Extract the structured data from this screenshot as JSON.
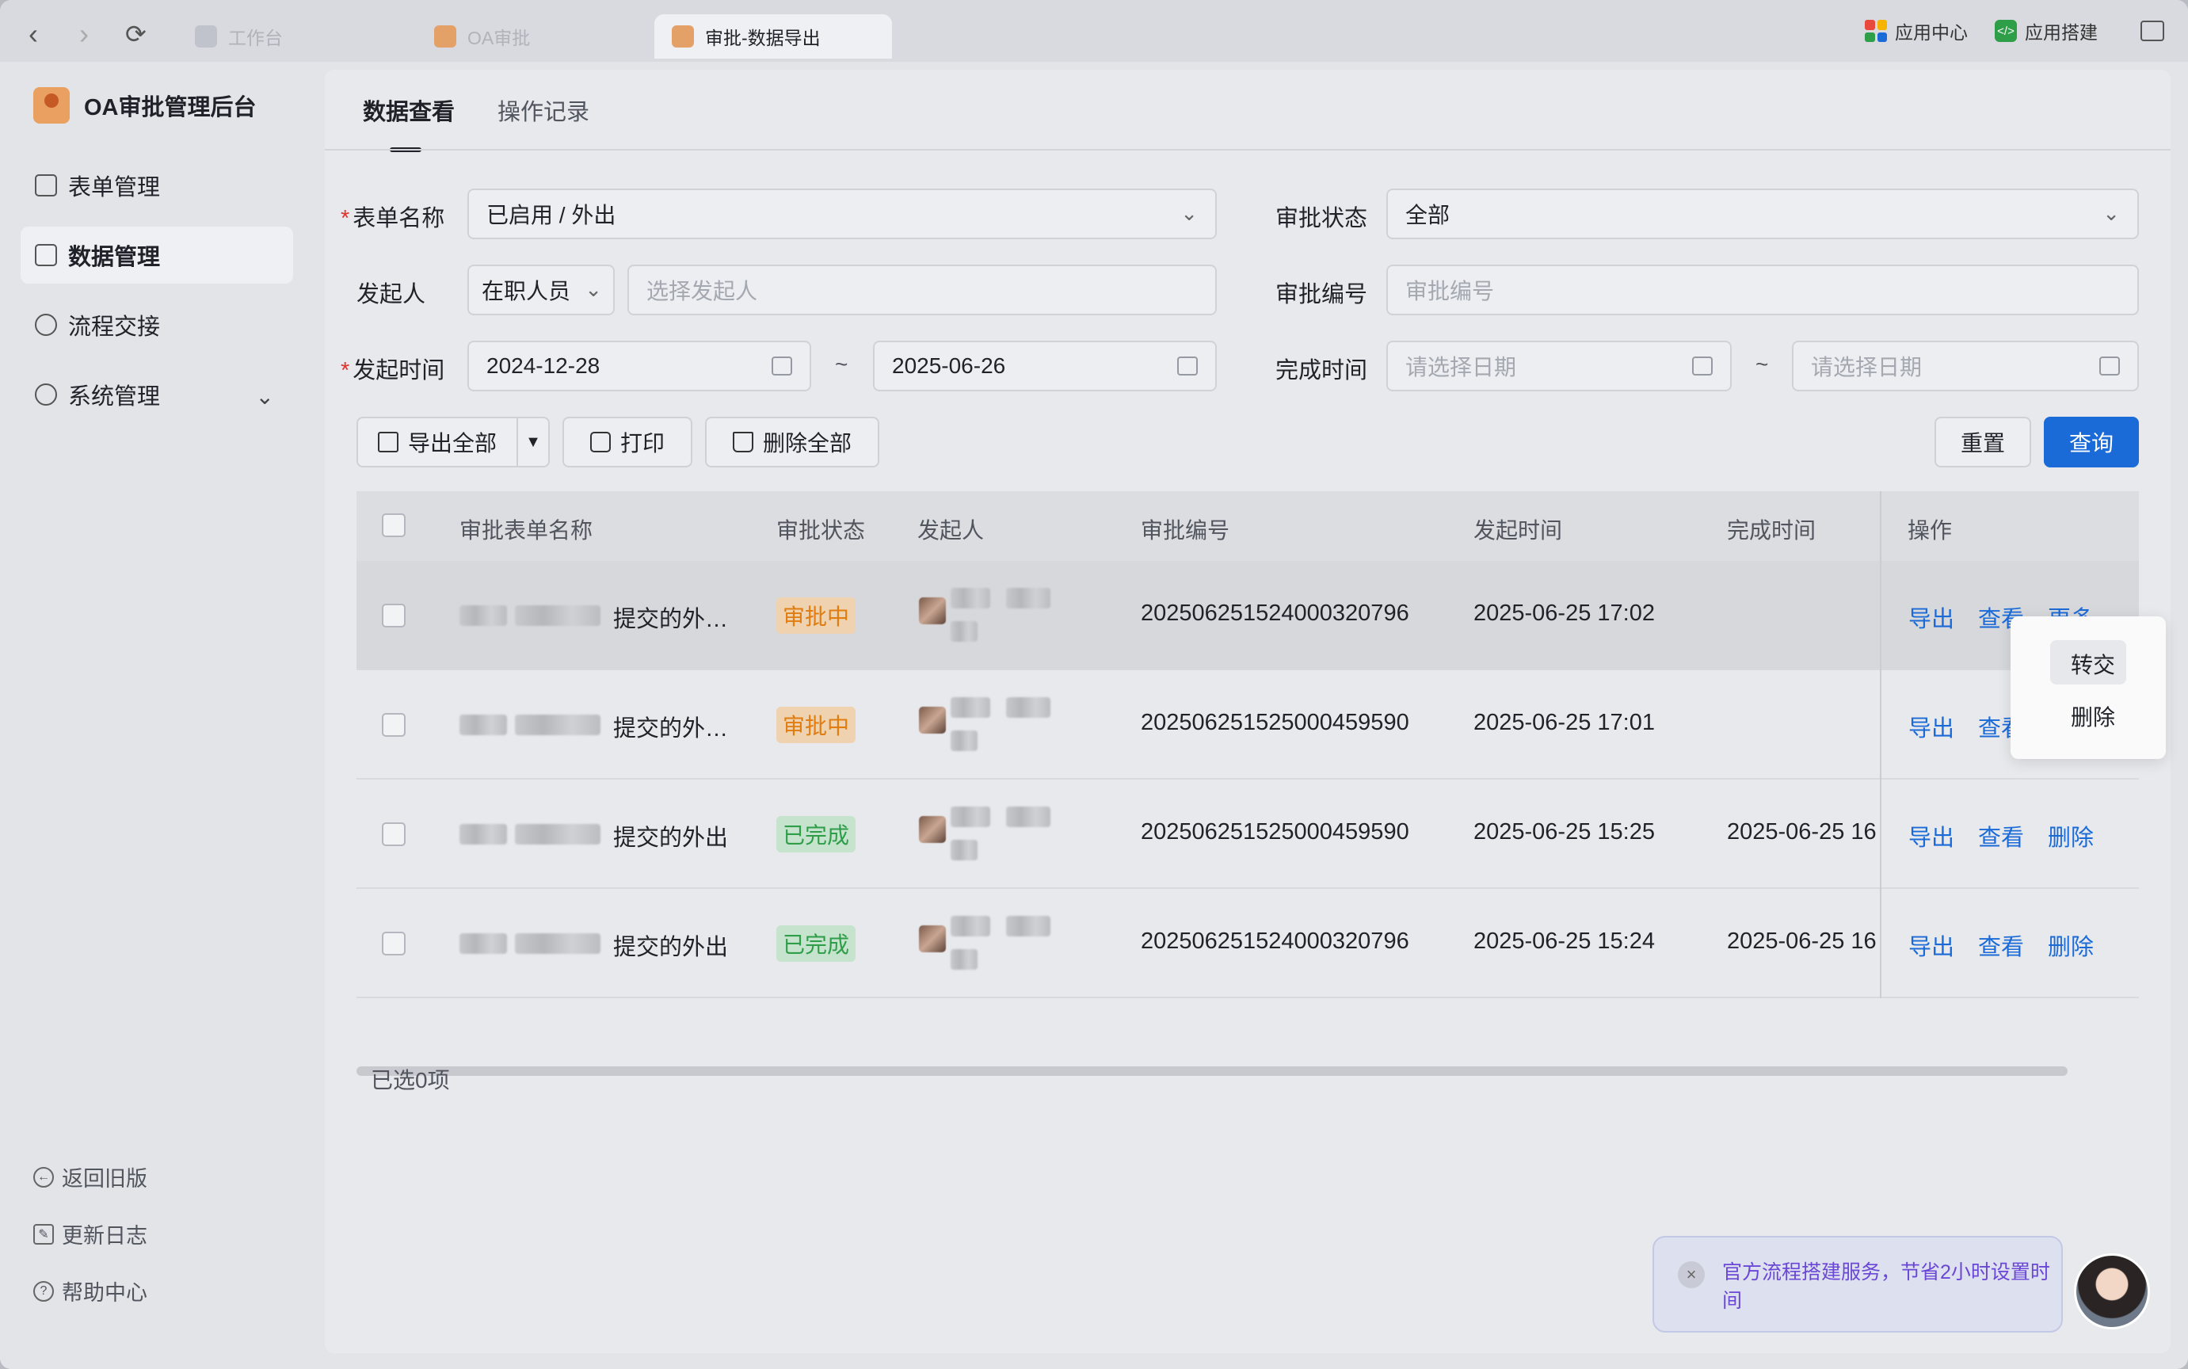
{
  "browser": {
    "tabs": [
      {
        "label": "工作台"
      },
      {
        "label": "OA审批"
      },
      {
        "label": "审批-数据导出"
      }
    ],
    "app_center": "应用中心",
    "app_builder": "应用搭建"
  },
  "sidebar": {
    "brand": "OA审批管理后台",
    "items": [
      {
        "label": "表单管理"
      },
      {
        "label": "数据管理"
      },
      {
        "label": "流程交接"
      },
      {
        "label": "系统管理"
      }
    ],
    "footer": [
      {
        "label": "返回旧版"
      },
      {
        "label": "更新日志"
      },
      {
        "label": "帮助中心"
      }
    ]
  },
  "main": {
    "tabs": [
      {
        "label": "数据查看"
      },
      {
        "label": "操作记录"
      }
    ],
    "filters": {
      "form_name_label": "表单名称",
      "form_name_value": "已启用 / 外出",
      "status_label": "审批状态",
      "status_value": "全部",
      "initiator_label": "发起人",
      "initiator_scope": "在职人员",
      "initiator_placeholder": "选择发起人",
      "number_label": "审批编号",
      "number_placeholder": "审批编号",
      "start_time_label": "发起时间",
      "start_from": "2024-12-28",
      "start_to": "2025-06-26",
      "finish_time_label": "完成时间",
      "finish_from_placeholder": "请选择日期",
      "finish_to_placeholder": "请选择日期",
      "tilde": "~"
    },
    "actions": {
      "export_all": "导出全部",
      "print": "打印",
      "delete_all": "删除全部",
      "reset": "重置",
      "query": "查询"
    },
    "table": {
      "columns": [
        "审批表单名称",
        "审批状态",
        "发起人",
        "审批编号",
        "发起时间",
        "完成时间",
        "操作"
      ],
      "rows": [
        {
          "title": "提交的外…",
          "status": "审批中",
          "number": "20250625152400032079​6",
          "start": "2025-06-25 17:02",
          "finish": "",
          "ops": [
            "导出",
            "查看",
            "更多"
          ]
        },
        {
          "title": "提交的外…",
          "status": "审批中",
          "number": "202506251525000459590",
          "start": "2025-06-25 17:01",
          "finish": "",
          "ops": [
            "导出",
            "查看"
          ]
        },
        {
          "title": "提交的外出",
          "status": "已完成",
          "number": "202506251525000459590",
          "start": "2025-06-25 15:25",
          "finish": "2025-06-25 16",
          "ops": [
            "导出",
            "查看",
            "删除"
          ]
        },
        {
          "title": "提交的外出",
          "status": "已完成",
          "number": "202506251524000320796",
          "start": "2025-06-25 15:24",
          "finish": "2025-06-25 16",
          "ops": [
            "导出",
            "查看",
            "删除"
          ]
        }
      ]
    },
    "selected_count": "已选0项",
    "more_menu": [
      "转交",
      "删除"
    ]
  },
  "banner": {
    "text": "官方流程搭建服务，节省2小时设置时间",
    "close": "×"
  },
  "colors": {
    "primary": "#1a6ad8",
    "pending": "#e07c10",
    "done": "#2e9e48",
    "required": "#e0322f"
  }
}
